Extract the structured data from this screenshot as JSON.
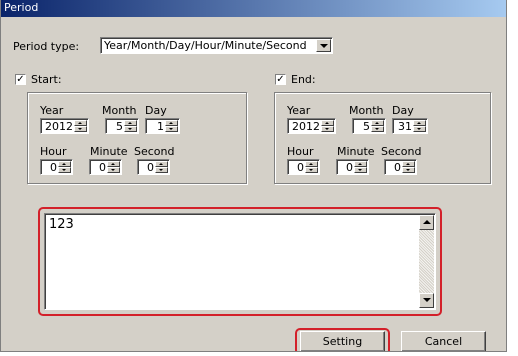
{
  "window": {
    "title": "Period"
  },
  "period_type": {
    "label": "Period type:",
    "value": "Year/Month/Day/Hour/Minute/Second"
  },
  "start": {
    "label": "Start:",
    "checked": true,
    "year": {
      "label": "Year",
      "value": "2012"
    },
    "month": {
      "label": "Month",
      "value": "5"
    },
    "day": {
      "label": "Day",
      "value": "1"
    },
    "hour": {
      "label": "Hour",
      "value": "0"
    },
    "minute": {
      "label": "Minute",
      "value": "0"
    },
    "second": {
      "label": "Second",
      "value": "0"
    }
  },
  "end": {
    "label": "End:",
    "checked": true,
    "year": {
      "label": "Year",
      "value": "2012"
    },
    "month": {
      "label": "Month",
      "value": "5"
    },
    "day": {
      "label": "Day",
      "value": "31"
    },
    "hour": {
      "label": "Hour",
      "value": "0"
    },
    "minute": {
      "label": "Minute",
      "value": "0"
    },
    "second": {
      "label": "Second",
      "value": "0"
    }
  },
  "result": {
    "text": "123"
  },
  "buttons": {
    "setting": "Setting",
    "cancel": "Cancel"
  },
  "colors": {
    "highlight": "#d3202a",
    "dialog_bg": "#d4d0c8",
    "titlebar": "#0a246a"
  }
}
